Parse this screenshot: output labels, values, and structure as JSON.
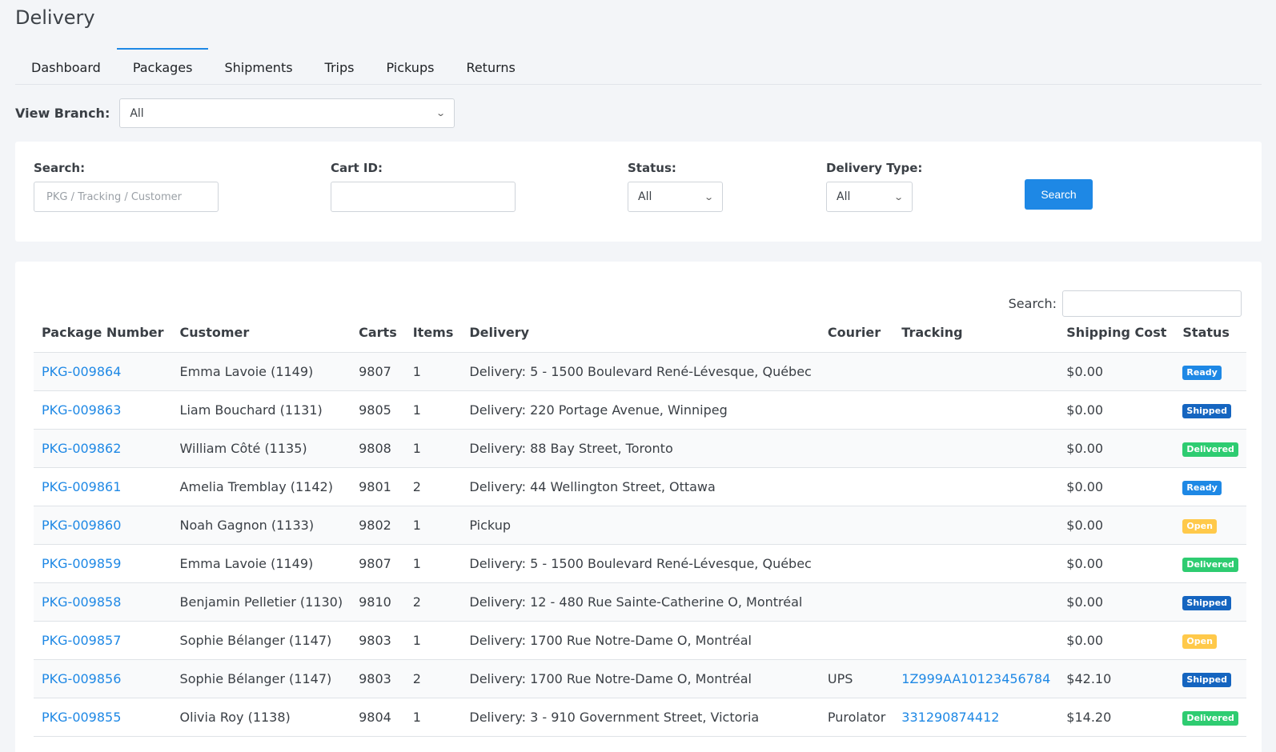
{
  "page": {
    "title": "Delivery"
  },
  "tabs": [
    {
      "label": "Dashboard",
      "active": false
    },
    {
      "label": "Packages",
      "active": true
    },
    {
      "label": "Shipments",
      "active": false
    },
    {
      "label": "Trips",
      "active": false
    },
    {
      "label": "Pickups",
      "active": false
    },
    {
      "label": "Returns",
      "active": false
    }
  ],
  "branch": {
    "label": "View Branch:",
    "value": "All"
  },
  "filters": {
    "search": {
      "label": "Search:",
      "placeholder": "PKG / Tracking / Customer",
      "value": ""
    },
    "cart_id": {
      "label": "Cart ID:",
      "value": ""
    },
    "status": {
      "label": "Status:",
      "value": "All"
    },
    "delivery_type": {
      "label": "Delivery Type:",
      "value": "All"
    },
    "search_button": "Search"
  },
  "table_search": {
    "label": "Search:",
    "value": ""
  },
  "table": {
    "columns": [
      "Package Number",
      "Customer",
      "Carts",
      "Items",
      "Delivery",
      "Courier",
      "Tracking",
      "Shipping Cost",
      "Status"
    ],
    "rows": [
      {
        "package": "PKG-009864",
        "customer": "Emma Lavoie (1149)",
        "carts": "9807",
        "items": "1",
        "delivery": "Delivery: 5 - 1500 Boulevard René-Lévesque, Québec",
        "courier": "",
        "tracking": "",
        "cost": "$0.00",
        "status": "Ready",
        "status_color": "#1e88e5"
      },
      {
        "package": "PKG-009863",
        "customer": "Liam Bouchard (1131)",
        "carts": "9805",
        "items": "1",
        "delivery": "Delivery: 220 Portage Avenue, Winnipeg",
        "courier": "",
        "tracking": "",
        "cost": "$0.00",
        "status": "Shipped",
        "status_color": "#1565c0"
      },
      {
        "package": "PKG-009862",
        "customer": "William Côté (1135)",
        "carts": "9808",
        "items": "1",
        "delivery": "Delivery: 88 Bay Street, Toronto",
        "courier": "",
        "tracking": "",
        "cost": "$0.00",
        "status": "Delivered",
        "status_color": "#2ecc71"
      },
      {
        "package": "PKG-009861",
        "customer": "Amelia Tremblay (1142)",
        "carts": "9801",
        "items": "2",
        "delivery": "Delivery: 44 Wellington Street, Ottawa",
        "courier": "",
        "tracking": "",
        "cost": "$0.00",
        "status": "Ready",
        "status_color": "#1e88e5"
      },
      {
        "package": "PKG-009860",
        "customer": "Noah Gagnon (1133)",
        "carts": "9802",
        "items": "1",
        "delivery": "Pickup",
        "courier": "",
        "tracking": "",
        "cost": "$0.00",
        "status": "Open",
        "status_color": "#ffc94a"
      },
      {
        "package": "PKG-009859",
        "customer": "Emma Lavoie (1149)",
        "carts": "9807",
        "items": "1",
        "delivery": "Delivery: 5 - 1500 Boulevard René-Lévesque, Québec",
        "courier": "",
        "tracking": "",
        "cost": "$0.00",
        "status": "Delivered",
        "status_color": "#2ecc71"
      },
      {
        "package": "PKG-009858",
        "customer": "Benjamin Pelletier (1130)",
        "carts": "9810",
        "items": "2",
        "delivery": "Delivery: 12 - 480 Rue Sainte-Catherine O, Montréal",
        "courier": "",
        "tracking": "",
        "cost": "$0.00",
        "status": "Shipped",
        "status_color": "#1565c0"
      },
      {
        "package": "PKG-009857",
        "customer": "Sophie Bélanger (1147)",
        "carts": "9803",
        "items": "1",
        "delivery": "Delivery: 1700 Rue Notre-Dame O, Montréal",
        "courier": "",
        "tracking": "",
        "cost": "$0.00",
        "status": "Open",
        "status_color": "#ffc94a"
      },
      {
        "package": "PKG-009856",
        "customer": "Sophie Bélanger (1147)",
        "carts": "9803",
        "items": "2",
        "delivery": "Delivery: 1700 Rue Notre-Dame O, Montréal",
        "courier": "UPS",
        "tracking": "1Z999AA10123456784",
        "cost": "$42.10",
        "status": "Shipped",
        "status_color": "#1565c0"
      },
      {
        "package": "PKG-009855",
        "customer": "Olivia Roy (1138)",
        "carts": "9804",
        "items": "1",
        "delivery": "Delivery: 3 - 910 Government Street, Victoria",
        "courier": "Purolator",
        "tracking": "331290874412",
        "cost": "$14.20",
        "status": "Delivered",
        "status_color": "#2ecc71"
      }
    ]
  },
  "colors": {
    "accent": "#1e88e5",
    "background": "#f3f5f8"
  }
}
